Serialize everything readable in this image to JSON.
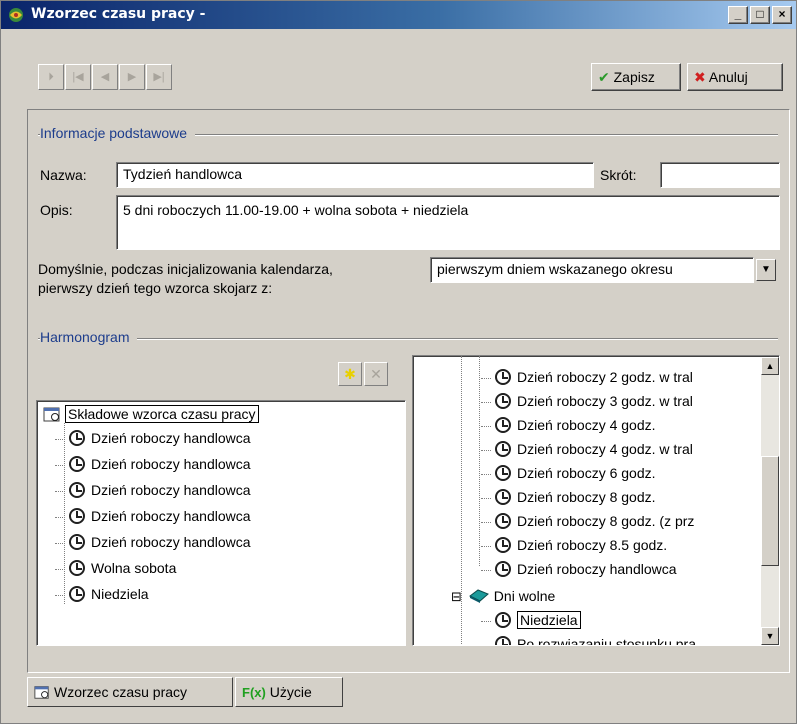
{
  "window": {
    "title": "Wzorzec czasu pracy -",
    "min_label": "_",
    "max_label": "□",
    "close_label": "×"
  },
  "toolbar": {
    "nav_first": "⏵",
    "nav_prev_start": "|◀",
    "nav_prev": "◀",
    "nav_next": "▶",
    "nav_last": "▶|",
    "save_icon": "✔",
    "save_label": "Zapisz",
    "cancel_icon": "✖",
    "cancel_label": "Anuluj"
  },
  "info": {
    "section_title": "Informacje podstawowe",
    "name_label": "Nazwa:",
    "name_value": "Tydzień handlowca",
    "short_label": "Skrót:",
    "short_value": "",
    "desc_label": "Opis:",
    "desc_value": "5 dni roboczych 11.00-19.00 + wolna sobota + niedziela",
    "default_text_line1": "Domyślnie, podczas inicjalizowania kalendarza,",
    "default_text_line2": "pierwszy dzień tego wzorca skojarz z:",
    "default_select_value": "pierwszym dniem wskazanego okresu"
  },
  "harmonogram": {
    "section_title": "Harmonogram",
    "add_icon": "✱",
    "delete_icon": "✕",
    "left_root": "Składowe wzorca czasu pracy",
    "left_items": [
      "Dzień roboczy handlowca",
      "Dzień roboczy handlowca",
      "Dzień roboczy handlowca",
      "Dzień roboczy handlowca",
      "Dzień roboczy handlowca",
      "Wolna sobota",
      "Niedziela"
    ],
    "right_items": [
      "Dzień roboczy 2 godz. w tral",
      "Dzień roboczy 3 godz. w tral",
      "Dzień roboczy 4 godz.",
      "Dzień roboczy 4 godz. w tral",
      "Dzień roboczy 6 godz.",
      "Dzień roboczy 8 godz.",
      "Dzień roboczy 8 godz. (z prz",
      "Dzień roboczy 8.5 godz.",
      "Dzień roboczy handlowca"
    ],
    "right_folder": "Dni wolne",
    "right_folder_toggle": "⊟",
    "right_sub_items": [
      "Niedziela",
      "Po rozwiązaniu stosunku pra"
    ]
  },
  "tabs": [
    {
      "label": "Wzorzec czasu pracy",
      "icon": "calendar-icon"
    },
    {
      "label": "Użycie",
      "icon": "function-icon",
      "icon_text": "F(x)"
    }
  ],
  "colors": {
    "title_gradient_start": "#0a246a",
    "section_title": "#1c3c8c",
    "window_bg": "#d4d0c8",
    "save_icon": "#2a9a2a",
    "cancel_icon": "#d02020"
  }
}
